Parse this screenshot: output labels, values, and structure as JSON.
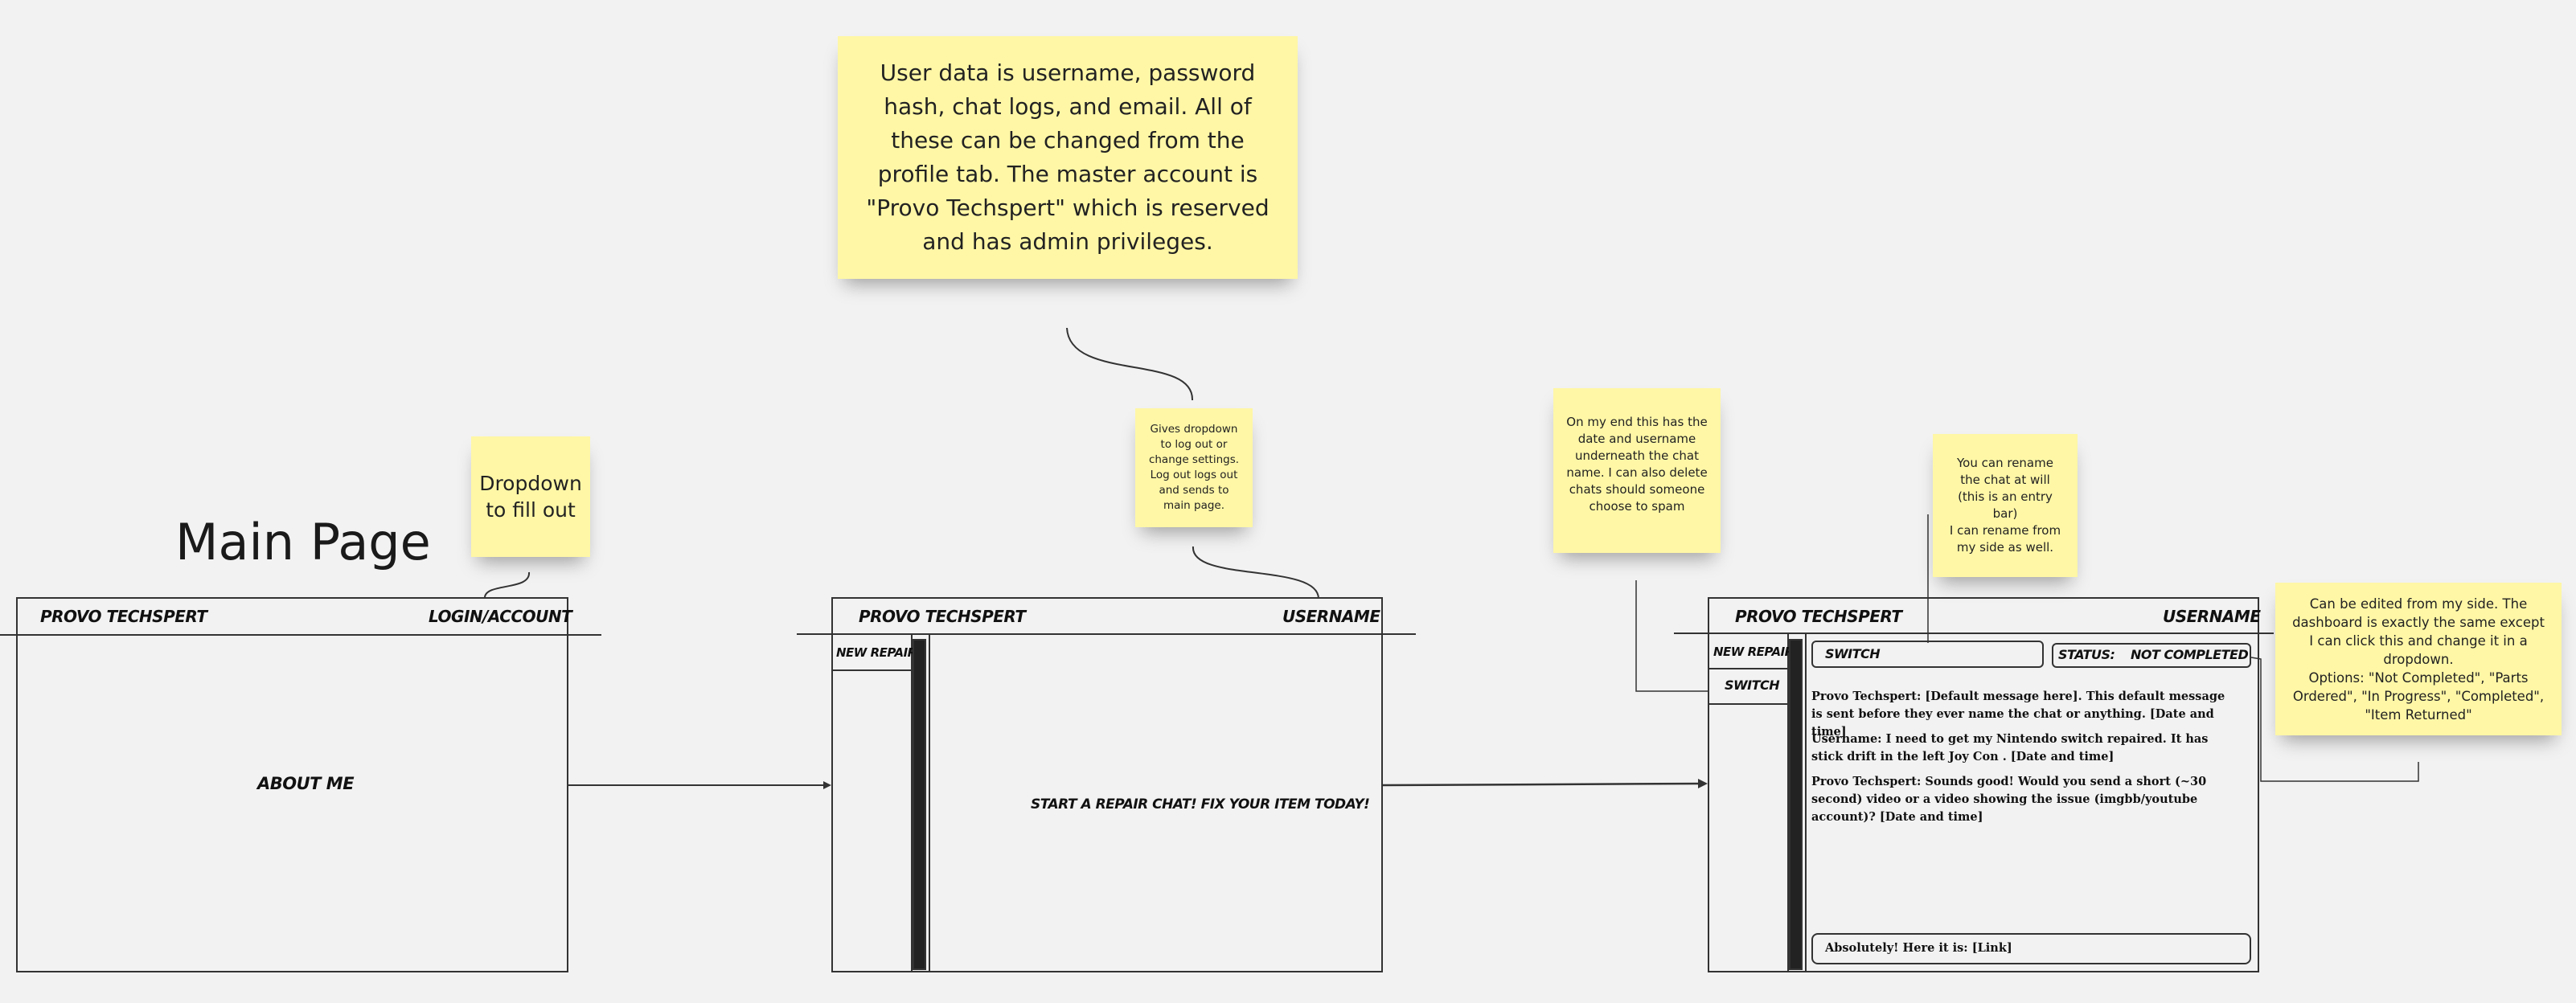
{
  "title": "Main Page",
  "notes": {
    "user_data": "User data is username, password hash, chat logs, and email. All of these can be changed from the profile tab. The master account is \"Provo Techspert\" which is reserved and has admin privileges.",
    "dropdown_fill": "Dropdown to fill out",
    "gives_dropdown": "Gives dropdown to log out or change settings. Log out logs out and sends to main page.",
    "my_end": "On my end this has the date and username underneath the chat name. I can also delete chats should someone choose to spam",
    "rename": "You can rename the chat at will (this is an entry bar)\nI can rename from my side as well.",
    "status_edit": "Can be edited from my side. The dashboard is exactly the same except I can click this and change it in a dropdown.\nOptions: \"Not Completed\", \"Parts Ordered\", \"In Progress\", \"Completed\", \"Item Returned\""
  },
  "screen1": {
    "brand": "PROVO TECHSPERT",
    "login": "LOGIN/ACCOUNT",
    "body": "ABOUT ME"
  },
  "screen2": {
    "brand": "PROVO TECHSPERT",
    "username": "USERNAME",
    "new_repair": "NEW REPAIR",
    "body": "START A REPAIR CHAT! FIX YOUR ITEM TODAY!"
  },
  "screen3": {
    "brand": "PROVO TECHSPERT",
    "username": "USERNAME",
    "new_repair": "NEW REPAIR",
    "switch_tab": "SWITCH",
    "chat_name": "SWITCH",
    "status_label": "STATUS:",
    "status_value": "NOT COMPLETED",
    "messages": [
      "Provo Techspert: [Default message here]. This default message is sent before they ever name the chat or anything. [Date and time]",
      "Username: I need to get my  Nintendo switch repaired. It has stick drift in the left Joy Con .  [Date and time]",
      "Provo Techspert: Sounds good! Would you send a short (~30 second) video or a video showing the issue (imgbb/youtube account)? [Date and time]"
    ],
    "entry": "Absolutely! Here it is: [Link]"
  }
}
